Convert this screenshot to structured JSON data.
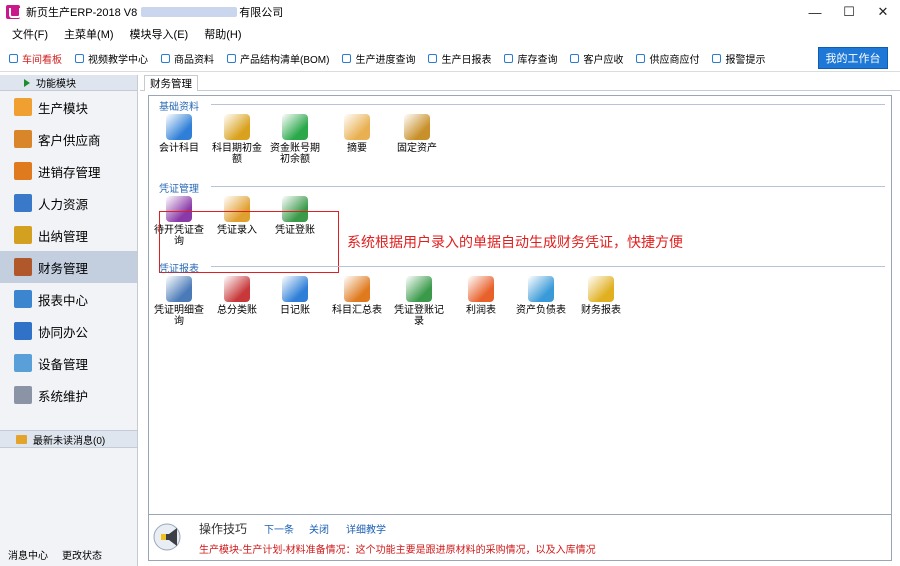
{
  "window": {
    "title_prefix": "新页生产ERP-2018 V8",
    "title_suffix": "有限公司",
    "controls": {
      "minimize": "—",
      "maximize": "☐",
      "close": "✕"
    }
  },
  "menu": [
    "文件(F)",
    "主菜单(M)",
    "模块导入(E)",
    "帮助(H)"
  ],
  "quickbar": {
    "items": [
      "车间看板",
      "视频教学中心",
      "商品资料",
      "产品结构清单(BOM)",
      "生产进度查询",
      "生产日报表",
      "库存查询",
      "客户应收",
      "供应商应付",
      "报警提示"
    ],
    "workbench_label": "我的工作台",
    "active_color": "#d02020",
    "accent": "#1e78d7"
  },
  "sidebar": {
    "header": "功能模块",
    "items": [
      {
        "label": "生产模块",
        "icon": "folder-icon",
        "color": "#f0a030"
      },
      {
        "label": "客户供应商",
        "icon": "users-icon",
        "color": "#d9862a"
      },
      {
        "label": "进销存管理",
        "icon": "bar-chart-icon",
        "color": "#e07a1f"
      },
      {
        "label": "人力资源",
        "icon": "person-icon",
        "color": "#3a78c9"
      },
      {
        "label": "出纳管理",
        "icon": "coins-icon",
        "color": "#d4a020"
      },
      {
        "label": "财务管理",
        "icon": "ledger-icon",
        "color": "#b0582c"
      },
      {
        "label": "报表中心",
        "icon": "report-icon",
        "color": "#3c86d0"
      },
      {
        "label": "协同办公",
        "icon": "calendar-icon",
        "color": "#2f72c8"
      },
      {
        "label": "设备管理",
        "icon": "device-icon",
        "color": "#5aa0d8"
      },
      {
        "label": "系统维护",
        "icon": "lock-icon",
        "color": "#8a94a6"
      }
    ],
    "selected_index": 5,
    "messages": "最新未读消息(0)",
    "footer": [
      "消息中心",
      "更改状态"
    ]
  },
  "main": {
    "tab": "财务管理",
    "sections": [
      {
        "title": "基础资料",
        "tiles": [
          {
            "label": "会计科目",
            "icon": "database-icon",
            "color": "#2f7fd8"
          },
          {
            "label": "科目期初金额",
            "icon": "coins-icon",
            "color": "#d9a21e"
          },
          {
            "label": "资金账号期初余额",
            "icon": "dollar-icon",
            "color": "#2aa84a"
          },
          {
            "label": "摘要",
            "icon": "note-icon",
            "color": "#e8b050"
          },
          {
            "label": "固定资产",
            "icon": "safe-icon",
            "color": "#c8902a"
          }
        ]
      },
      {
        "title": "凭证管理",
        "tiles": [
          {
            "label": "待开凭证查询",
            "icon": "search-doc-icon",
            "color": "#8a3aa8"
          },
          {
            "label": "凭证录入",
            "icon": "edit-icon",
            "color": "#e0a030"
          },
          {
            "label": "凭证登账",
            "icon": "books-icon",
            "color": "#3a9a4a"
          }
        ]
      },
      {
        "title": "凭证报表",
        "tiles": [
          {
            "label": "凭证明细查询",
            "icon": "person-search-icon",
            "color": "#4a7ab8"
          },
          {
            "label": "总分类账",
            "icon": "pie-chart-icon",
            "color": "#c8383a"
          },
          {
            "label": "日记账",
            "icon": "notebook-icon",
            "color": "#2f7fd8"
          },
          {
            "label": "科目汇总表",
            "icon": "bar-chart-icon",
            "color": "#e07a1f"
          },
          {
            "label": "凭证登账记录",
            "icon": "books-icon",
            "color": "#3a9a4a"
          },
          {
            "label": "利润表",
            "icon": "pie-chart-icon",
            "color": "#e8602a"
          },
          {
            "label": "资产负债表",
            "icon": "pie-chart-icon",
            "color": "#3a9ad8"
          },
          {
            "label": "财务报表",
            "icon": "coins-icon",
            "color": "#e0b020"
          }
        ]
      }
    ],
    "annotation": "系统根据用户录入的单据自动生成财务凭证，快捷方便"
  },
  "tips": {
    "title": "操作技巧",
    "links": [
      "下一条",
      "关闭",
      "详细教学"
    ],
    "text": "生产模块-生产计划-材料准备情况：这个功能主要是跟进原材料的采购情况，以及入库情况"
  }
}
